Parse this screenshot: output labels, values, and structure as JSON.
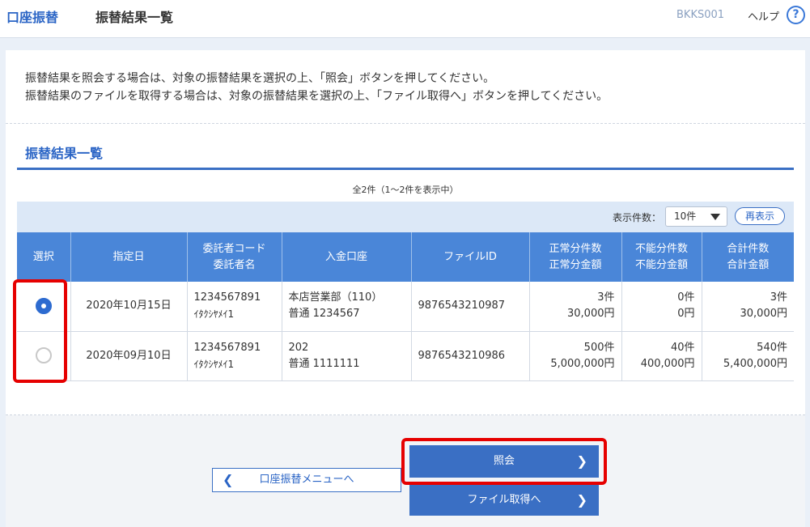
{
  "header": {
    "brand": "口座振替",
    "title": "振替結果一覧",
    "screen_id": "BKKS001",
    "help_label": "ヘルプ",
    "help_icon_glyph": "?"
  },
  "intro": {
    "line1": "振替結果を照会する場合は、対象の振替結果を選択の上、「照会」ボタンを押してください。",
    "line2": "振替結果のファイルを取得する場合は、対象の振替結果を選択の上、「ファイル取得へ」ボタンを押してください。"
  },
  "section": {
    "title": "振替結果一覧",
    "count_note": "全2件（1～2件を表示中）"
  },
  "toolbar": {
    "per_page_label": "表示件数：",
    "per_page_value": "10件",
    "redisplay_label": "再表示"
  },
  "table": {
    "headers": {
      "select": "選択",
      "date": "指定日",
      "consignor_code": "委託者コード",
      "consignor_name": "委託者名",
      "account": "入金口座",
      "file_id": "ファイルID",
      "normal_count": "正常分件数",
      "normal_amount": "正常分金額",
      "failed_count": "不能分件数",
      "failed_amount": "不能分金額",
      "total_count": "合計件数",
      "total_amount": "合計金額"
    },
    "rows": [
      {
        "selected": true,
        "date": "2020年10月15日",
        "consignor_code": "1234567891",
        "consignor_name": "ｲﾀｸｼﾔﾒｲ1",
        "account_branch": "本店営業部（110）",
        "account_number": "普通 1234567",
        "file_id": "9876543210987",
        "normal_count": "3件",
        "normal_amount": "30,000円",
        "failed_count": "0件",
        "failed_amount": "0円",
        "total_count": "3件",
        "total_amount": "30,000円"
      },
      {
        "selected": false,
        "date": "2020年09月10日",
        "consignor_code": "1234567891",
        "consignor_name": "ｲﾀｸｼﾔﾒｲ1",
        "account_branch": "202",
        "account_number": "普通 1111111",
        "file_id": "9876543210986",
        "normal_count": "500件",
        "normal_amount": "5,000,000円",
        "failed_count": "40件",
        "failed_amount": "400,000円",
        "total_count": "540件",
        "total_amount": "5,400,000円"
      }
    ]
  },
  "buttons": {
    "back_label": "口座振替メニューへ",
    "inquiry_label": "照会",
    "file_label": "ファイル取得へ"
  },
  "colors": {
    "accent": "#3a6fc4",
    "header_blue": "#4a86d8",
    "highlight_red": "#e60000"
  }
}
